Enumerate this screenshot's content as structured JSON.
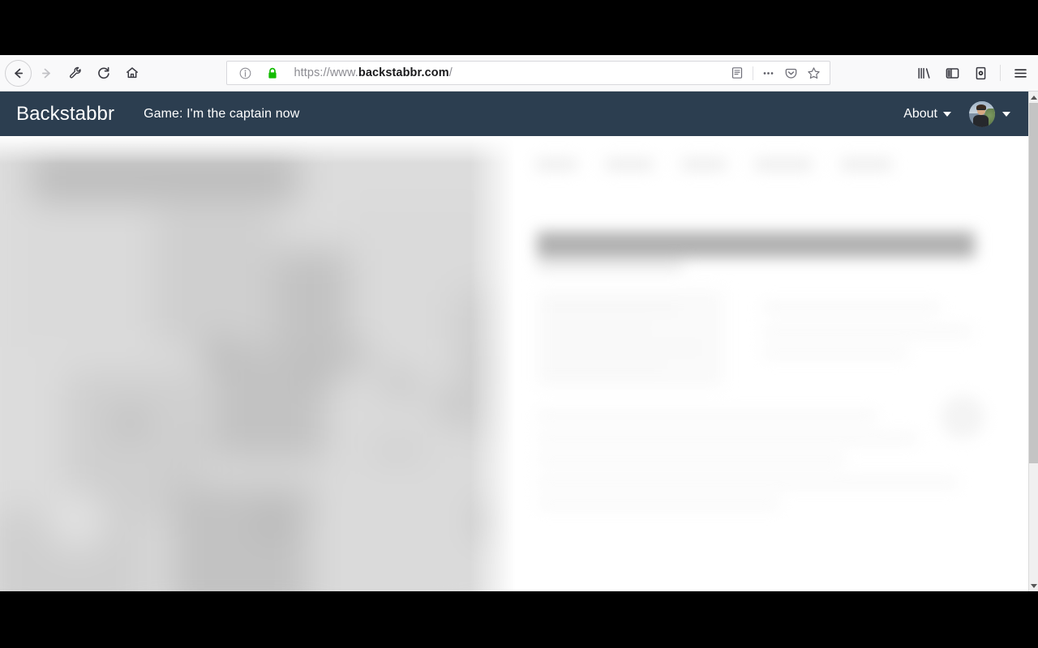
{
  "browser": {
    "url_display": {
      "scheme_prefix": "https://www.",
      "domain": "backstabbr.com",
      "path": "/"
    },
    "url_full": "https://www.backstabbr.com/",
    "nav": {
      "back_label": "Back",
      "forward_label": "Forward",
      "devtools_label": "Developer Tools",
      "reload_label": "Reload",
      "home_label": "Home"
    },
    "identity": {
      "info_icon": "page-info-icon",
      "lock_icon": "secure-lock-icon",
      "lock_color": "#12bc00"
    },
    "urlbar_actions": [
      {
        "name": "reader-mode-icon",
        "label": "Reader View"
      },
      {
        "name": "page-actions-icon",
        "label": "Page actions"
      },
      {
        "name": "pocket-icon",
        "label": "Save to Pocket"
      },
      {
        "name": "bookmark-star-icon",
        "label": "Bookmark this page"
      }
    ],
    "toolbar_right": [
      {
        "name": "library-icon",
        "label": "Library"
      },
      {
        "name": "sidebar-icon",
        "label": "Sidebars"
      },
      {
        "name": "screenshot-icon",
        "label": "Take a Screenshot"
      },
      {
        "name": "hamburger-menu-icon",
        "label": "Open menu"
      }
    ]
  },
  "site": {
    "brand": "Backstabbr",
    "game_title": "Game: I'm the captain now",
    "about_label": "About",
    "navbar_color": "#2c3e50",
    "user": {
      "avatar_alt": "user-avatar",
      "menu_caret": "chevron-down-icon"
    }
  },
  "scrollbar": {
    "up_arrow": "scroll-up-arrow",
    "down_arrow": "scroll-down-arrow",
    "thumb_position_percent": 0
  }
}
